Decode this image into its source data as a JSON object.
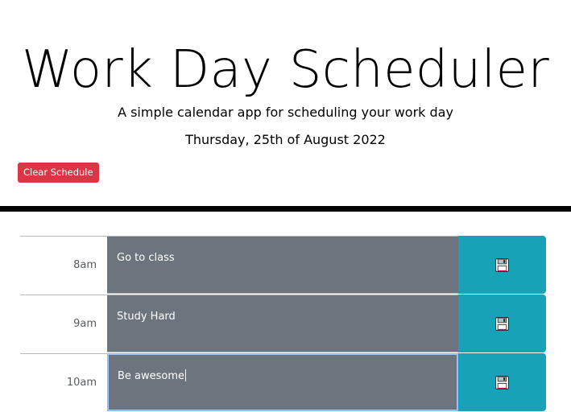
{
  "header": {
    "title": "Work Day Scheduler",
    "subtitle": "A simple calendar app for scheduling your work day",
    "current_day": "Thursday, 25th of August 2022",
    "clear_button": "Clear Schedule"
  },
  "timeblocks": [
    {
      "hour": "8am",
      "text": "Go to class",
      "save_icon": "floppy-disk-icon"
    },
    {
      "hour": "9am",
      "text": "Study Hard",
      "save_icon": "floppy-disk-icon"
    },
    {
      "hour": "10am",
      "text": "Be awesome",
      "save_icon": "floppy-disk-icon"
    }
  ],
  "colors": {
    "clear_button_bg": "#dc3545",
    "textarea_bg": "#6c757d",
    "save_button_bg": "#17a2b8"
  }
}
